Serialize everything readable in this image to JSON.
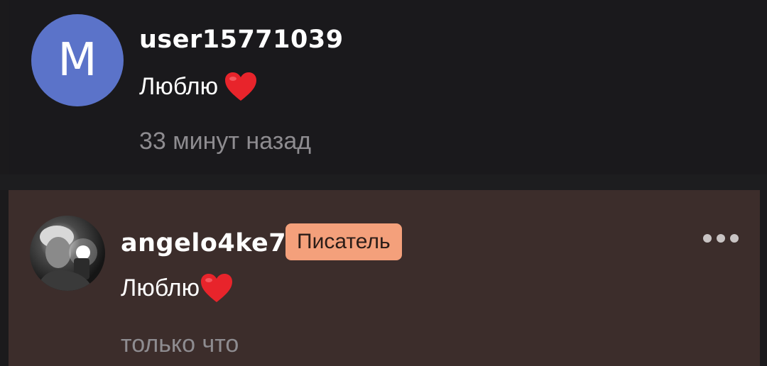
{
  "comments": [
    {
      "avatar_letter": "M",
      "username": "user15771039",
      "text": "Люблю",
      "emoji": "heart",
      "time": "33 минут назад",
      "colors": {
        "avatar_bg": "#5b73c9",
        "bg": "#1a191c"
      }
    },
    {
      "username": "angelo4ke7",
      "badge": "Писатель",
      "text": "Люблю",
      "emoji": "heart",
      "time": "только что",
      "more_icon": "more-horizontal-icon",
      "colors": {
        "badge_bg": "#f4a07b",
        "bg": "#3c2d2b"
      }
    }
  ]
}
